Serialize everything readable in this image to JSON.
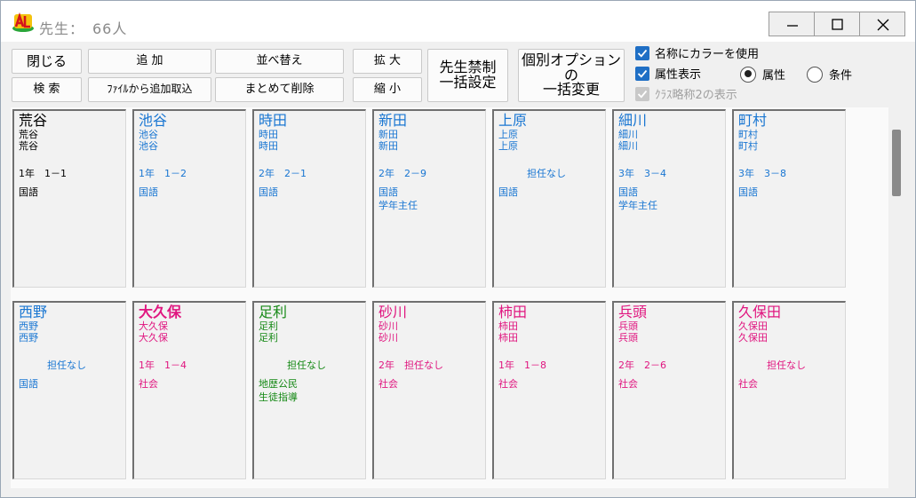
{
  "window": {
    "title": "先生：　66人",
    "buttons": {
      "minimize": "minimize-icon",
      "maximize": "maximize-icon",
      "close": "close-icon"
    }
  },
  "toolbar": {
    "close_label": "閉じる",
    "add_label": "追 加",
    "sort_label": "並べ替え",
    "zoom_in_label": "拡 大",
    "search_label": "検 索",
    "import_label": "ﾌｧｲﾙから追加取込",
    "bulk_delete_label": "まとめて削除",
    "zoom_out_label": "縮 小",
    "bulk_prohibit_label": "先生禁制\n一括設定",
    "bulk_option_label": "個別オプションの\n一括変更"
  },
  "options": {
    "use_color_label": "名称にカラーを使用",
    "use_color_checked": true,
    "show_attr_label": "属性表示",
    "show_attr_checked": true,
    "class_abbr_label": "ｸﾗｽ略称2の表示",
    "class_abbr_checked": true,
    "radio_attr_label": "属性",
    "radio_cond_label": "条件",
    "radio_selected": "属性"
  },
  "colors": {
    "black": "#000000",
    "blue": "#1976d2",
    "green": "#148814",
    "pink": "#e0157f"
  },
  "teachers": [
    {
      "name": "荒谷",
      "abbr1": "荒谷",
      "abbr2": "荒谷",
      "class": "1年　1－1",
      "subjects": "国語",
      "color": "black",
      "bold": false,
      "centered": false
    },
    {
      "name": "池谷",
      "abbr1": "池谷",
      "abbr2": "池谷",
      "class": "1年　1－2",
      "subjects": "国語",
      "color": "blue",
      "bold": false,
      "centered": false
    },
    {
      "name": "時田",
      "abbr1": "時田",
      "abbr2": "時田",
      "class": "2年　2－1",
      "subjects": "国語",
      "color": "blue",
      "bold": false,
      "centered": false
    },
    {
      "name": "新田",
      "abbr1": "新田",
      "abbr2": "新田",
      "class": "2年　2－9",
      "subjects": "国語\n学年主任",
      "color": "blue",
      "bold": false,
      "centered": false
    },
    {
      "name": "上原",
      "abbr1": "上原",
      "abbr2": "上原",
      "class": "担任なし",
      "subjects": "国語",
      "color": "blue",
      "bold": false,
      "centered": true
    },
    {
      "name": "細川",
      "abbr1": "細川",
      "abbr2": "細川",
      "class": "3年　3－4",
      "subjects": "国語\n学年主任",
      "color": "blue",
      "bold": false,
      "centered": false
    },
    {
      "name": "町村",
      "abbr1": "町村",
      "abbr2": "町村",
      "class": "3年　3－8",
      "subjects": "国語",
      "color": "blue",
      "bold": false,
      "centered": false
    },
    {
      "name": "西野",
      "abbr1": "西野",
      "abbr2": "西野",
      "class": "担任なし",
      "subjects": "国語",
      "color": "blue",
      "bold": false,
      "centered": true
    },
    {
      "name": "大久保",
      "abbr1": "大久保",
      "abbr2": "大久保",
      "class": "1年　1－4",
      "subjects": "社会",
      "color": "pink",
      "bold": true,
      "centered": false
    },
    {
      "name": "足利",
      "abbr1": "足利",
      "abbr2": "足利",
      "class": "担任なし",
      "subjects": "地歴公民\n生徒指導",
      "color": "green",
      "bold": false,
      "centered": true
    },
    {
      "name": "砂川",
      "abbr1": "砂川",
      "abbr2": "砂川",
      "class": "2年　担任なし",
      "subjects": "社会",
      "color": "pink",
      "bold": false,
      "centered": false
    },
    {
      "name": "柿田",
      "abbr1": "柿田",
      "abbr2": "柿田",
      "class": "1年　1－8",
      "subjects": "社会",
      "color": "pink",
      "bold": false,
      "centered": false
    },
    {
      "name": "兵頭",
      "abbr1": "兵頭",
      "abbr2": "兵頭",
      "class": "2年　2－6",
      "subjects": "社会",
      "color": "pink",
      "bold": false,
      "centered": false
    },
    {
      "name": "久保田",
      "abbr1": "久保田",
      "abbr2": "久保田",
      "class": "担任なし",
      "subjects": "社会",
      "color": "pink",
      "bold": false,
      "centered": true
    }
  ]
}
